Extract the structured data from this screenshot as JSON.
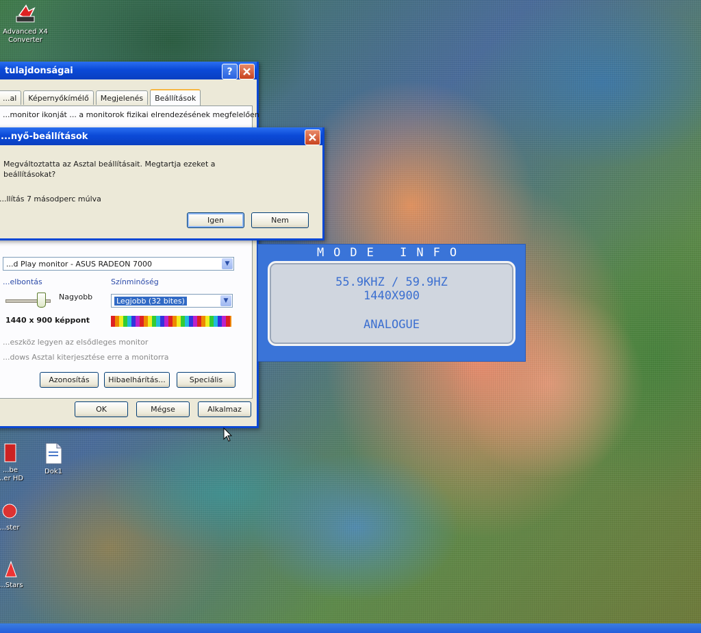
{
  "desktop": {
    "icons": [
      {
        "label": "Advanced X4\nConverter",
        "icon": "app-icon"
      },
      {
        "label": "Dok1",
        "icon": "document-icon"
      },
      {
        "label": "...be\n...er HD",
        "icon": "app-icon"
      },
      {
        "label": "...ster",
        "icon": "app-icon"
      },
      {
        "label": "...Stars",
        "icon": "app-icon"
      }
    ]
  },
  "properties_window": {
    "title": "tulajdonságai",
    "tabs": [
      "...al",
      "Képernyőkímélő",
      "Megjelenés",
      "Beállítások"
    ],
    "active_tab": "Beállítások",
    "instruction": "...monitor ikonját ... a monitorok fizikai elrendezésének megfelelően",
    "display_select": "...d Play monitor - ASUS RADEON 7000",
    "resolution": {
      "group_label": "...elbontás",
      "slider_label": "Nagyobb",
      "value": "1440 x 900 képpont"
    },
    "color_quality": {
      "group_label": "Színminőség",
      "selected": "Legjobb (32 bites)"
    },
    "checkboxes": [
      "...eszköz legyen az elsődleges monitor",
      "...dows Asztal kiterjesztése erre a monitorra"
    ],
    "buttons": {
      "identify": "Azonosítás",
      "troubleshoot": "Hibaelhárítás...",
      "advanced": "Speciális",
      "ok": "OK",
      "cancel": "Mégse",
      "apply": "Alkalmaz"
    }
  },
  "confirm_dialog": {
    "title": "...nyő-beállítások",
    "message": "Megváltoztatta az Asztal beállításait. Megtartja ezeket a beállításokat?",
    "countdown": "...llítás 7 másodperc múlva",
    "buttons": {
      "yes": "Igen",
      "no": "Nem"
    }
  },
  "osd": {
    "title": "MODE INFO",
    "frequency": "55.9KHZ / 59.9HZ",
    "resolution": "1440X900",
    "signal": "ANALOGUE"
  }
}
